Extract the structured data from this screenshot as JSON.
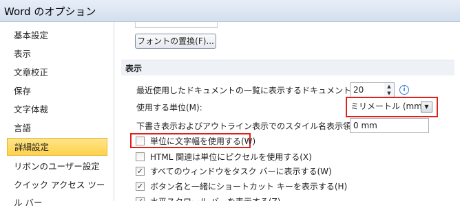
{
  "window": {
    "title": "Word のオプション"
  },
  "sidebar": {
    "items": [
      {
        "label": "基本設定"
      },
      {
        "label": "表示"
      },
      {
        "label": "文章校正"
      },
      {
        "label": "保存"
      },
      {
        "label": "文字体裁"
      },
      {
        "label": "言語"
      },
      {
        "label": "詳細設定",
        "selected": true
      },
      {
        "label": "リボンのユーザー設定"
      },
      {
        "label": "クイック アクセス ツール バー"
      }
    ]
  },
  "main": {
    "font_replace_button": "フォントの置換(F)...",
    "section_title": "表示",
    "recent_docs": {
      "label": "最近使用したドキュメントの一覧に表示するドキュメントの数(R):",
      "value": "20"
    },
    "units": {
      "label": "使用する単位(M):",
      "value": "ミリメートル (mm)"
    },
    "style_area": {
      "label": "下書き表示およびアウトライン表示でのスタイル名表示領域(E):",
      "value": "0 mm"
    },
    "checkboxes": [
      {
        "label": "単位に文字幅を使用する(W)",
        "checked": false
      },
      {
        "label": "HTML 関連は単位にピクセルを使用する(X)",
        "checked": false
      },
      {
        "label": "すべてのウィンドウをタスク バーに表示する(W)",
        "checked": true
      },
      {
        "label": "ボタン名と一緒にショートカット キーを表示する(H)",
        "checked": true
      },
      {
        "label": "水平スクロール バーを表示する(Z)",
        "checked": true
      }
    ],
    "highlight_color": "#e0201a"
  }
}
